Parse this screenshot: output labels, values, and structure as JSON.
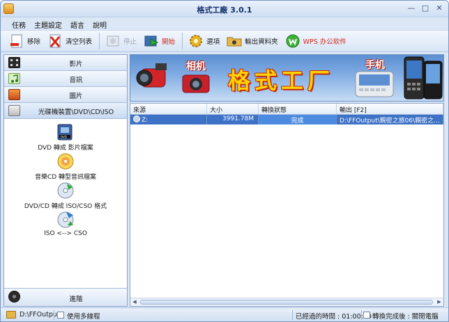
{
  "window": {
    "title": "格式工廠 3.0.1"
  },
  "menu": [
    "任務",
    "主題設定",
    "語言",
    "說明"
  ],
  "toolbar": {
    "remove": "移除",
    "clear": "清空列表",
    "stop": "停止",
    "start": "開始",
    "options": "選項",
    "output_folder": "輸出資料夾",
    "wps": "WPS 办公软件"
  },
  "sidebar": {
    "categories": [
      "影片",
      "音訊",
      "圖片",
      "光碟機裝置\\DVD\\CD\\ISO"
    ],
    "tools": [
      "DVD 轉成 影片檔案",
      "音樂CD 轉型音訊檔案",
      "DVD/CD 轉成 ISO/CSO 格式",
      "ISO <--> CSO"
    ],
    "advanced": "進階"
  },
  "banner": {
    "title": "格式工厂",
    "camera_label": "相机",
    "phone_label": "手机"
  },
  "table": {
    "headers": [
      "來源",
      "大小",
      "轉換狀態",
      "輸出 [F2]"
    ],
    "rows": [
      {
        "source": "Z:",
        "size": "3991.78M",
        "status": "完成",
        "progress": 1.0,
        "output": "D:\\FFOutput\\親密之旅06\\親密之..."
      }
    ]
  },
  "statusbar": {
    "output_path": "D:\\FFOutput",
    "multithread": "使用多線程",
    "elapsed": "已經過的時間 : 01:00:30",
    "after_done": "轉換完成後 : 關閉電腦"
  },
  "colors": {
    "selection": "#3d72c6",
    "title_accent": "#ffd200"
  }
}
